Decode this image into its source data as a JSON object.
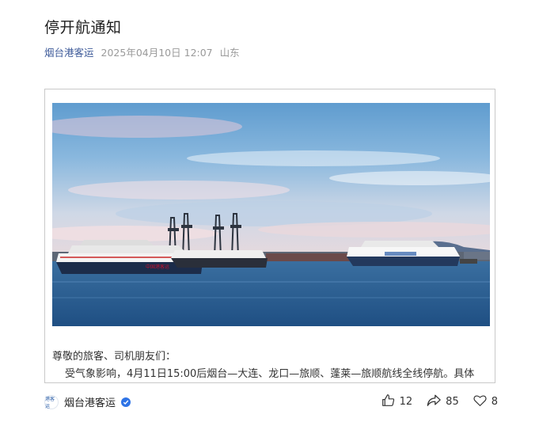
{
  "article": {
    "title": "停开航通知",
    "source": "烟台港客运",
    "datetime": "2025年04月10日 12:07",
    "location": "山东",
    "greeting": "尊敬的旅客、司机朋友们：",
    "body_first_line": "受气象影响，4月11日15:00后烟台—大连、龙口—旅顺、蓬莱—旅顺航线全线停航。具体"
  },
  "photo": {
    "ferry_left_hull_text": "中国港客运"
  },
  "footer": {
    "author_name": "烟台港客运",
    "avatar_text": "港客运",
    "like_count": "12",
    "share_count": "85",
    "favorite_count": "8"
  },
  "colors": {
    "source_link": "#3d5a99",
    "verified_badge": "#2f74e6"
  }
}
